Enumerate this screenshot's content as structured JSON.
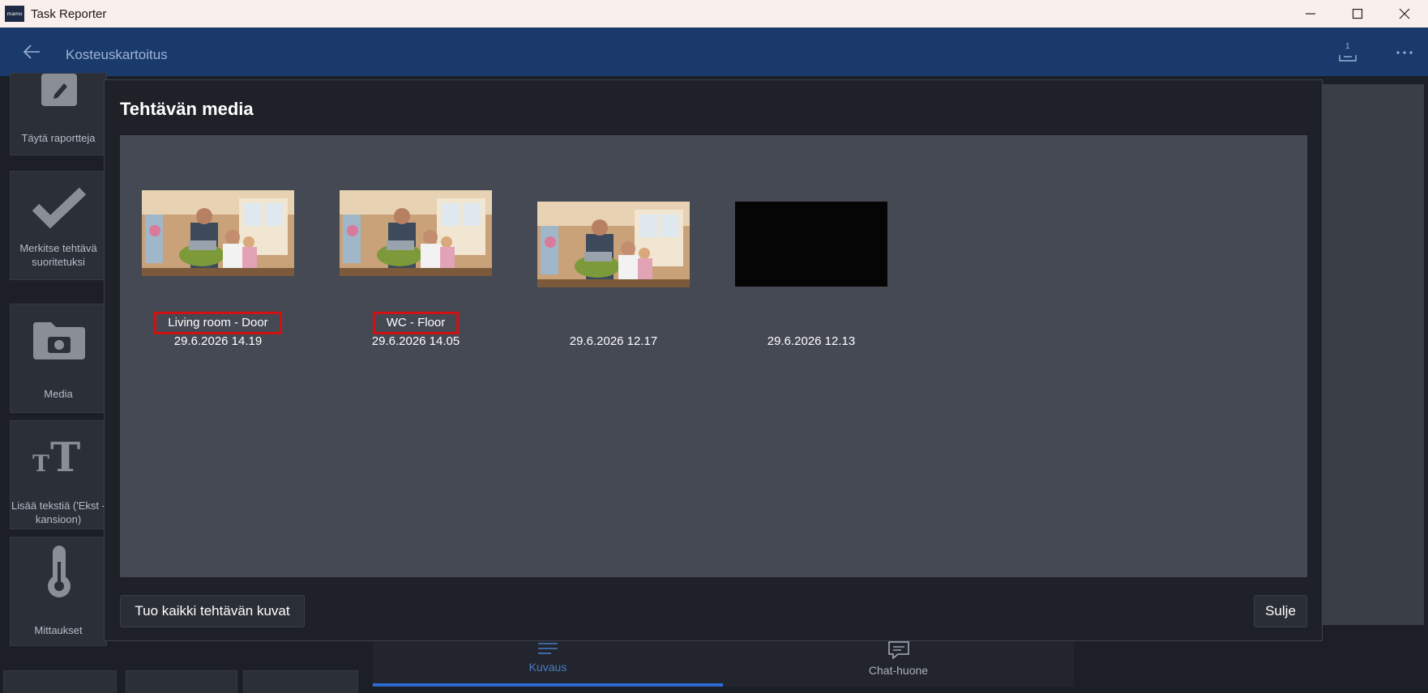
{
  "window": {
    "app_title": "Task Reporter",
    "logo_text": "mamo",
    "minimize_icon": "minimize-icon",
    "maximize_icon": "maximize-icon",
    "close_icon": "close-icon"
  },
  "appbar": {
    "title": "Kosteuskartoitus",
    "upload_count": "1",
    "accent": "#193a6b"
  },
  "sidebar": {
    "items": [
      {
        "label": "Täytä raportteja",
        "icon": "edit-icon"
      },
      {
        "label": "Merkitse tehtävä suoritetuksi",
        "icon": "checkmark-icon"
      },
      {
        "label": "Media",
        "icon": "camera-folder-icon"
      },
      {
        "label": "Lisää tekstiä ('Ekst -kansioon)",
        "icon": "text-size-icon"
      },
      {
        "label": "Mittaukset",
        "icon": "thermometer-icon"
      }
    ]
  },
  "tabs": [
    {
      "label": "Kuvaus",
      "icon": "description-icon",
      "active": true
    },
    {
      "label": "Chat-huone",
      "icon": "chat-icon",
      "active": false
    }
  ],
  "modal": {
    "title": "Tehtävän media",
    "import_button": "Tuo kaikki tehtävän kuvat",
    "close_button": "Sulje",
    "media": [
      {
        "label": "Living room - Door",
        "date": "29.6.2026 14.19",
        "type": "photo"
      },
      {
        "label": "WC - Floor",
        "date": "29.6.2026 14.05",
        "type": "photo"
      },
      {
        "label": "",
        "date": "29.6.2026 12.17",
        "type": "photo"
      },
      {
        "label": "",
        "date": "29.6.2026 12.13",
        "type": "black"
      }
    ],
    "highlight_color": "#d01212"
  }
}
